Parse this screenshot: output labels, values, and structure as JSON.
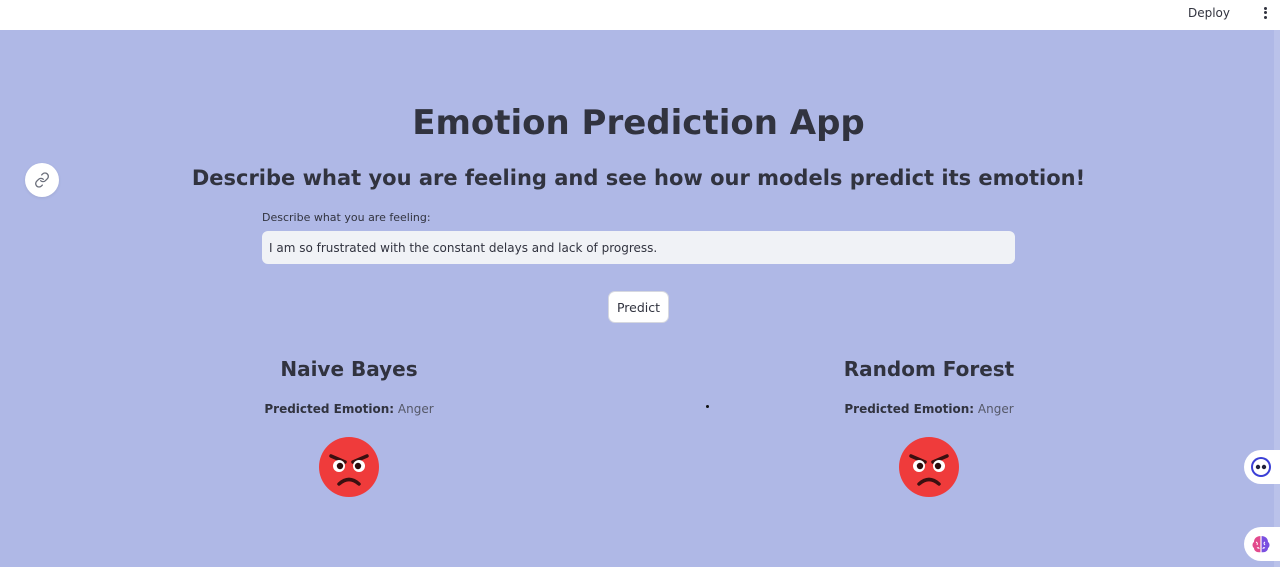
{
  "header": {
    "deploy_label": "Deploy",
    "menu_icon": "kebab-menu-icon"
  },
  "anchor": {
    "icon": "link-icon"
  },
  "page": {
    "title": "Emotion Prediction App",
    "subtitle": "Describe what you are feeling and see how our models predict its emotion!"
  },
  "input": {
    "label": "Describe what you are feeling:",
    "value": "I am so frustrated with the constant delays and lack of progress."
  },
  "actions": {
    "predict_label": "Predict"
  },
  "results": [
    {
      "model": "Naive Bayes",
      "label": "Predicted Emotion:",
      "emotion": "Anger",
      "emoji": "angry-face-icon"
    },
    {
      "model": "Random Forest",
      "label": "Predicted Emotion:",
      "emotion": "Anger",
      "emoji": "angry-face-icon"
    }
  ],
  "side_widgets": [
    {
      "icon": "chat-bot-icon"
    },
    {
      "icon": "brain-icon"
    }
  ],
  "colors": {
    "background": "#afb8e6",
    "text": "#31333f",
    "emoji_red": "#ef3b3b"
  }
}
